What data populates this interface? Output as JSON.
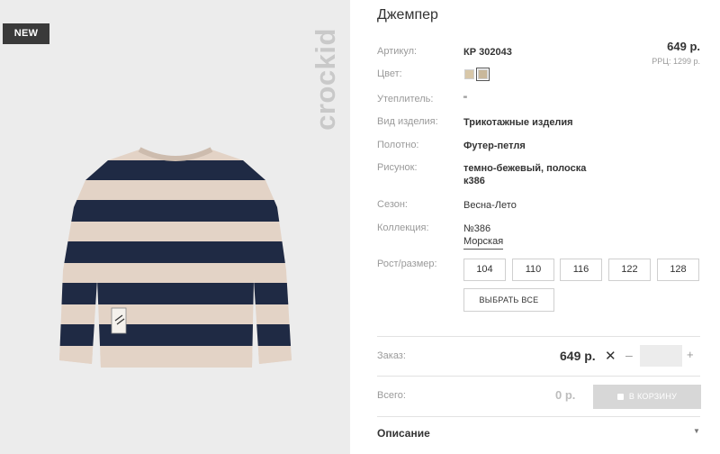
{
  "badge": "NEW",
  "brand": "crockid",
  "title": "Джемпер",
  "price": "649 р.",
  "rrp": "РРЦ: 1299 р.",
  "details": [
    {
      "label": "Артикул:",
      "value": "КР 302043"
    },
    {
      "label": "Цвет:",
      "value": ""
    },
    {
      "label": "Утеплитель:",
      "value": "\""
    },
    {
      "label": "Вид изделия:",
      "value": "Трикотажные изделия"
    },
    {
      "label": "Полотно:",
      "value": "Футер-петля"
    },
    {
      "label": "Рисунок:",
      "value": "темно-бежевый, полоска к386"
    },
    {
      "label": "Сезон:",
      "value": "Весна-Лето"
    },
    {
      "label": "Коллекция:",
      "value": "№386 Морская"
    },
    {
      "label": "Рост/размер:",
      "value": ""
    }
  ],
  "colors": [
    {
      "name": "beige",
      "hex": "#d8c7a8"
    },
    {
      "name": "dark-beige",
      "hex": "#c9b89b",
      "selected": true
    }
  ],
  "sizes": [
    "104",
    "110",
    "116",
    "122",
    "128"
  ],
  "select_all": "ВЫБРАТЬ ВСЕ",
  "order": {
    "label": "Заказ:",
    "price": "649 р.",
    "times": "✕",
    "minus": "–",
    "plus": "+",
    "qty": ""
  },
  "total": {
    "label": "Всего:",
    "value": "0 р."
  },
  "cart_button": "В КОРЗИНУ",
  "description": "Описание",
  "description_arrow": "▼",
  "palette": {
    "navy": "#1f2a44",
    "stripe_beige": "#e3d3c6",
    "photo_bg": "#ececec"
  }
}
